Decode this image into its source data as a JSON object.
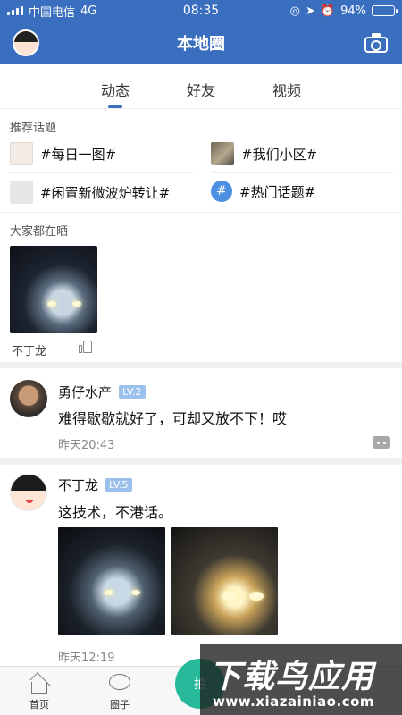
{
  "status_bar": {
    "carrier": "中国电信",
    "network": "4G",
    "time": "08:35",
    "battery": "94%",
    "battery_level": 0.94
  },
  "header": {
    "title": "本地圈",
    "avatar_icon": "cartoon-avatar-icon",
    "camera_icon": "camera-icon"
  },
  "tabs": [
    {
      "label": "动态",
      "active": true
    },
    {
      "label": "好友",
      "active": false
    },
    {
      "label": "视频",
      "active": false
    }
  ],
  "topics": {
    "label": "推荐话题",
    "items": [
      "#每日一图#",
      "#我们小区#",
      "#闲置新微波炉转让#",
      "#热门话题#"
    ]
  },
  "everyone": {
    "label": "大家都在晒",
    "user": "不丁龙"
  },
  "posts": [
    {
      "user": "勇仔水产",
      "level": "LV.2",
      "text": "难得歇歇就好了，可却又放不下！哎",
      "time": "昨天20:43"
    },
    {
      "user": "不丁龙",
      "level": "LV.5",
      "text": "这技术，不港话。",
      "time": "昨天12:19"
    }
  ],
  "bottom_nav": {
    "items": [
      "首页",
      "圈子"
    ],
    "fab_label": "拍"
  },
  "watermark": {
    "title": "下载鸟应用",
    "url": "www.xiazainiao.com"
  },
  "colors": {
    "primary": "#3a6fbf",
    "level_badge": "#9cc0ec",
    "fab": "#27b99a"
  }
}
